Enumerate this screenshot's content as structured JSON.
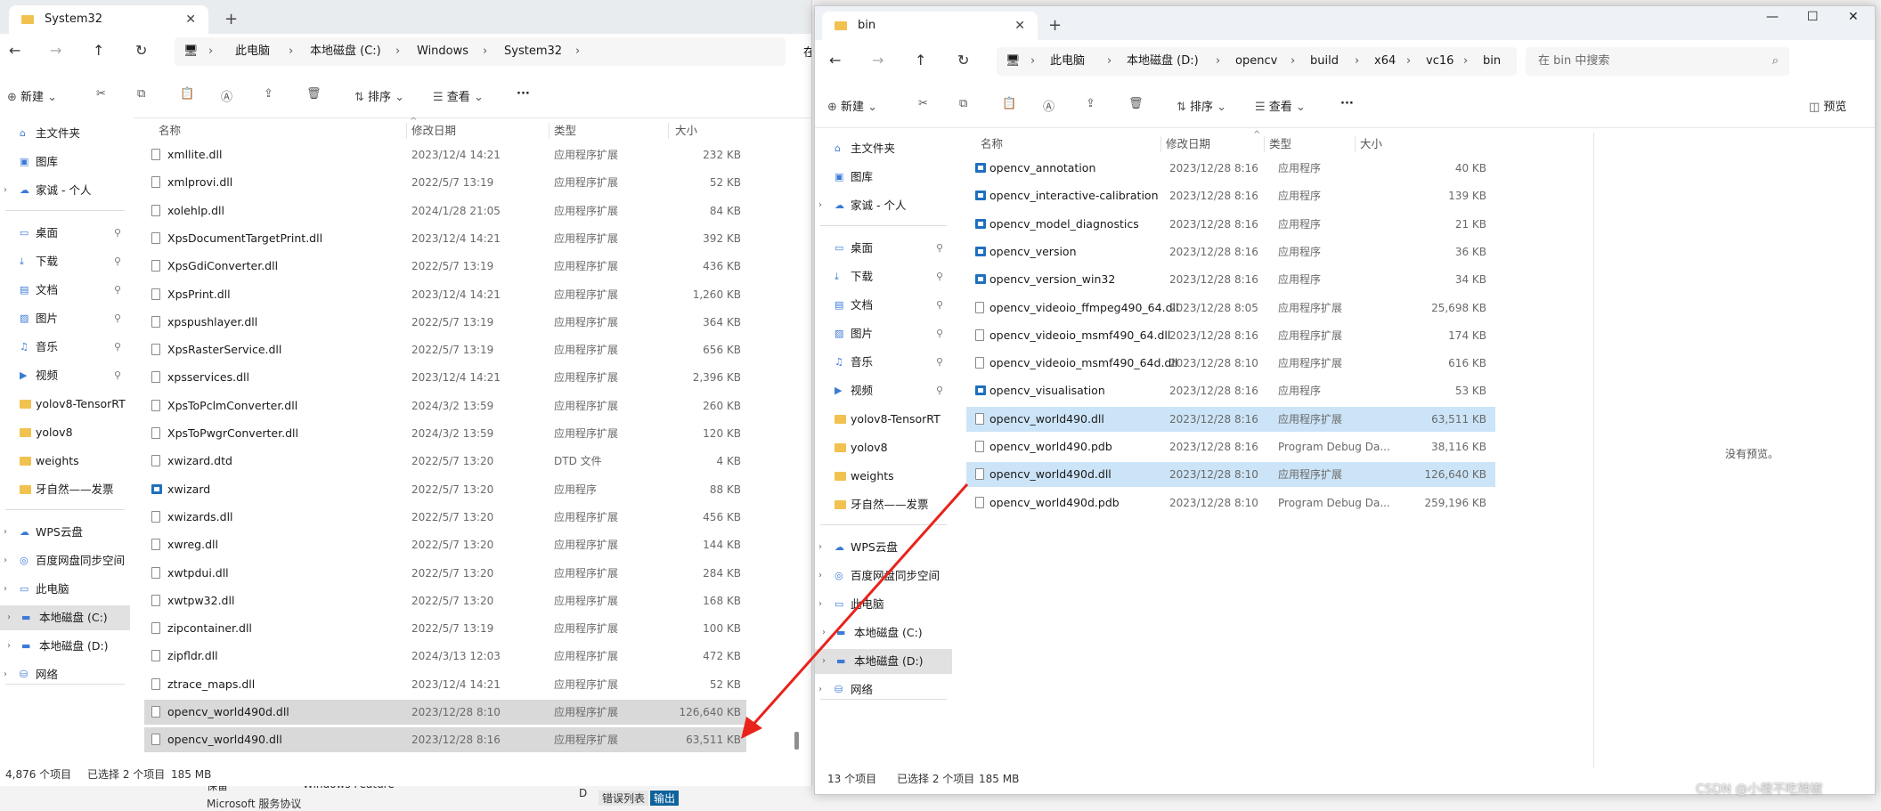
{
  "window_a": {
    "tab_title": "System32",
    "close_glyph": "✕",
    "newtab_glyph": "+",
    "breadcrumb": [
      "此电脑",
      "本地磁盘 (C:)",
      "Windows",
      "System32"
    ],
    "breadcrumb_overflow": "在",
    "toolbar": {
      "new": "新建",
      "sort": "排序",
      "view": "查看",
      "more": "···"
    },
    "columns": {
      "name": "名称",
      "date": "修改日期",
      "type": "类型",
      "size": "大小"
    },
    "sidebar": [
      {
        "label": "主文件夹",
        "icon": "home-icon"
      },
      {
        "label": "图库",
        "icon": "gallery-icon"
      },
      {
        "label": "家诚 - 个人",
        "icon": "cloud-icon",
        "expandable": true
      },
      {
        "label": "桌面",
        "icon": "desktop-icon",
        "pinned": true
      },
      {
        "label": "下载",
        "icon": "download-icon",
        "pinned": true
      },
      {
        "label": "文档",
        "icon": "document-icon",
        "pinned": true
      },
      {
        "label": "图片",
        "icon": "pictures-icon",
        "pinned": true
      },
      {
        "label": "音乐",
        "icon": "music-icon",
        "pinned": true
      },
      {
        "label": "视频",
        "icon": "video-icon",
        "pinned": true
      },
      {
        "label": "yolov8-TensorRT",
        "icon": "folder-icon"
      },
      {
        "label": "yolov8",
        "icon": "folder-icon"
      },
      {
        "label": "weights",
        "icon": "folder-icon"
      },
      {
        "label": "牙自然——发票",
        "icon": "folder-icon"
      },
      {
        "label": "WPS云盘",
        "icon": "cloud-icon",
        "expandable": true
      },
      {
        "label": "百度网盘同步空间",
        "icon": "sync-icon",
        "expandable": true
      },
      {
        "label": "此电脑",
        "icon": "computer-icon",
        "expandable": true
      },
      {
        "label": "本地磁盘 (C:)",
        "icon": "drive-icon",
        "expandable": true,
        "selected": true
      },
      {
        "label": "本地磁盘 (D:)",
        "icon": "drive-icon",
        "expandable": true
      },
      {
        "label": "网络",
        "icon": "network-icon",
        "expandable": true
      }
    ],
    "files": [
      {
        "name": "xmllite.dll",
        "date": "2023/12/4 14:21",
        "type": "应用程序扩展",
        "size": "232 KB"
      },
      {
        "name": "xmlprovi.dll",
        "date": "2022/5/7 13:19",
        "type": "应用程序扩展",
        "size": "52 KB"
      },
      {
        "name": "xolehlp.dll",
        "date": "2024/1/28 21:05",
        "type": "应用程序扩展",
        "size": "84 KB"
      },
      {
        "name": "XpsDocumentTargetPrint.dll",
        "date": "2023/12/4 14:21",
        "type": "应用程序扩展",
        "size": "392 KB"
      },
      {
        "name": "XpsGdiConverter.dll",
        "date": "2022/5/7 13:19",
        "type": "应用程序扩展",
        "size": "436 KB"
      },
      {
        "name": "XpsPrint.dll",
        "date": "2023/12/4 14:21",
        "type": "应用程序扩展",
        "size": "1,260 KB"
      },
      {
        "name": "xpspushlayer.dll",
        "date": "2022/5/7 13:19",
        "type": "应用程序扩展",
        "size": "364 KB"
      },
      {
        "name": "XpsRasterService.dll",
        "date": "2022/5/7 13:19",
        "type": "应用程序扩展",
        "size": "656 KB"
      },
      {
        "name": "xpsservices.dll",
        "date": "2023/12/4 14:21",
        "type": "应用程序扩展",
        "size": "2,396 KB"
      },
      {
        "name": "XpsToPclmConverter.dll",
        "date": "2024/3/2 13:59",
        "type": "应用程序扩展",
        "size": "260 KB"
      },
      {
        "name": "XpsToPwgrConverter.dll",
        "date": "2024/3/2 13:59",
        "type": "应用程序扩展",
        "size": "120 KB"
      },
      {
        "name": "xwizard.dtd",
        "date": "2022/5/7 13:20",
        "type": "DTD 文件",
        "size": "4 KB"
      },
      {
        "name": "xwizard",
        "date": "2022/5/7 13:20",
        "type": "应用程序",
        "size": "88 KB"
      },
      {
        "name": "xwizards.dll",
        "date": "2022/5/7 13:20",
        "type": "应用程序扩展",
        "size": "456 KB"
      },
      {
        "name": "xwreg.dll",
        "date": "2022/5/7 13:20",
        "type": "应用程序扩展",
        "size": "144 KB"
      },
      {
        "name": "xwtpdui.dll",
        "date": "2022/5/7 13:20",
        "type": "应用程序扩展",
        "size": "284 KB"
      },
      {
        "name": "xwtpw32.dll",
        "date": "2022/5/7 13:20",
        "type": "应用程序扩展",
        "size": "168 KB"
      },
      {
        "name": "zipcontainer.dll",
        "date": "2022/5/7 13:19",
        "type": "应用程序扩展",
        "size": "100 KB"
      },
      {
        "name": "zipfldr.dll",
        "date": "2024/3/13 12:03",
        "type": "应用程序扩展",
        "size": "472 KB"
      },
      {
        "name": "ztrace_maps.dll",
        "date": "2023/12/4 14:21",
        "type": "应用程序扩展",
        "size": "52 KB"
      },
      {
        "name": "opencv_world490d.dll",
        "date": "2023/12/28 8:10",
        "type": "应用程序扩展",
        "size": "126,640 KB",
        "selected": true
      },
      {
        "name": "opencv_world490.dll",
        "date": "2023/12/28 8:16",
        "type": "应用程序扩展",
        "size": "63,511 KB",
        "selected": true
      }
    ],
    "status": {
      "count": "4,876 个项目",
      "selected": "已选择 2 个项目",
      "size": "185 MB"
    }
  },
  "window_b": {
    "tab_title": "bin",
    "close_glyph": "✕",
    "newtab_glyph": "+",
    "window_controls": {
      "minimize": "—",
      "maximize": "☐",
      "close": "✕"
    },
    "breadcrumb": [
      "此电脑",
      "本地磁盘 (D:)",
      "opencv",
      "build",
      "x64",
      "vc16",
      "bin"
    ],
    "search_placeholder": "在 bin 中搜索",
    "toolbar": {
      "new": "新建",
      "sort": "排序",
      "view": "查看",
      "more": "···",
      "preview": "预览"
    },
    "columns": {
      "name": "名称",
      "date": "修改日期",
      "type": "类型",
      "size": "大小"
    },
    "sidebar": [
      {
        "label": "主文件夹",
        "icon": "home-icon"
      },
      {
        "label": "图库",
        "icon": "gallery-icon"
      },
      {
        "label": "家诚 - 个人",
        "icon": "cloud-icon",
        "expandable": true
      },
      {
        "label": "桌面",
        "icon": "desktop-icon",
        "pinned": true
      },
      {
        "label": "下载",
        "icon": "download-icon",
        "pinned": true
      },
      {
        "label": "文档",
        "icon": "document-icon",
        "pinned": true
      },
      {
        "label": "图片",
        "icon": "pictures-icon",
        "pinned": true
      },
      {
        "label": "音乐",
        "icon": "music-icon",
        "pinned": true
      },
      {
        "label": "视频",
        "icon": "video-icon",
        "pinned": true
      },
      {
        "label": "yolov8-TensorRT",
        "icon": "folder-icon"
      },
      {
        "label": "yolov8",
        "icon": "folder-icon"
      },
      {
        "label": "weights",
        "icon": "folder-icon"
      },
      {
        "label": "牙自然——发票",
        "icon": "folder-icon"
      },
      {
        "label": "WPS云盘",
        "icon": "cloud-icon",
        "expandable": true
      },
      {
        "label": "百度网盘同步空间",
        "icon": "sync-icon",
        "expandable": true
      },
      {
        "label": "此电脑",
        "icon": "computer-icon",
        "expandable": true
      },
      {
        "label": "本地磁盘 (C:)",
        "icon": "drive-icon",
        "expandable": true
      },
      {
        "label": "本地磁盘 (D:)",
        "icon": "drive-icon",
        "expandable": true,
        "selected": true
      },
      {
        "label": "网络",
        "icon": "network-icon",
        "expandable": true
      }
    ],
    "files": [
      {
        "name": "opencv_annotation",
        "date": "2023/12/28 8:16",
        "type": "应用程序",
        "size": "40 KB",
        "kind": "app"
      },
      {
        "name": "opencv_interactive-calibration",
        "date": "2023/12/28 8:16",
        "type": "应用程序",
        "size": "139 KB",
        "kind": "app"
      },
      {
        "name": "opencv_model_diagnostics",
        "date": "2023/12/28 8:16",
        "type": "应用程序",
        "size": "21 KB",
        "kind": "app"
      },
      {
        "name": "opencv_version",
        "date": "2023/12/28 8:16",
        "type": "应用程序",
        "size": "36 KB",
        "kind": "app"
      },
      {
        "name": "opencv_version_win32",
        "date": "2023/12/28 8:16",
        "type": "应用程序",
        "size": "34 KB",
        "kind": "app"
      },
      {
        "name": "opencv_videoio_ffmpeg490_64.dll",
        "date": "2023/12/28 8:05",
        "type": "应用程序扩展",
        "size": "25,698 KB",
        "kind": "dll"
      },
      {
        "name": "opencv_videoio_msmf490_64.dll",
        "date": "2023/12/28 8:16",
        "type": "应用程序扩展",
        "size": "174 KB",
        "kind": "dll"
      },
      {
        "name": "opencv_videoio_msmf490_64d.dll",
        "date": "2023/12/28 8:10",
        "type": "应用程序扩展",
        "size": "616 KB",
        "kind": "dll"
      },
      {
        "name": "opencv_visualisation",
        "date": "2023/12/28 8:16",
        "type": "应用程序",
        "size": "53 KB",
        "kind": "app"
      },
      {
        "name": "opencv_world490.dll",
        "date": "2023/12/28 8:16",
        "type": "应用程序扩展",
        "size": "63,511 KB",
        "kind": "dll",
        "selected": true
      },
      {
        "name": "opencv_world490.pdb",
        "date": "2023/12/28 8:16",
        "type": "Program Debug Da...",
        "size": "38,116 KB",
        "kind": "pdb"
      },
      {
        "name": "opencv_world490d.dll",
        "date": "2023/12/28 8:10",
        "type": "应用程序扩展",
        "size": "126,640 KB",
        "kind": "dll",
        "selected": true
      },
      {
        "name": "opencv_world490d.pdb",
        "date": "2023/12/28 8:10",
        "type": "Program Debug Da...",
        "size": "259,196 KB",
        "kind": "pdb"
      }
    ],
    "no_preview": "没有预览。",
    "status": {
      "count": "13 个项目",
      "selected": "已选择 2 个项目",
      "size": "185 MB"
    }
  },
  "background_fragments": {
    "left": "保留",
    "mid": "Windows Feature",
    "drive": "D",
    "tab1": "错误列表",
    "tab2": "输出",
    "ms": "Microsoft 服务协议"
  },
  "watermark": "CSDN @小橙不吃辣椒",
  "colors": {
    "selection": "#cce4f7",
    "arrow": "#e8231b",
    "folder": "#f1c24f"
  }
}
